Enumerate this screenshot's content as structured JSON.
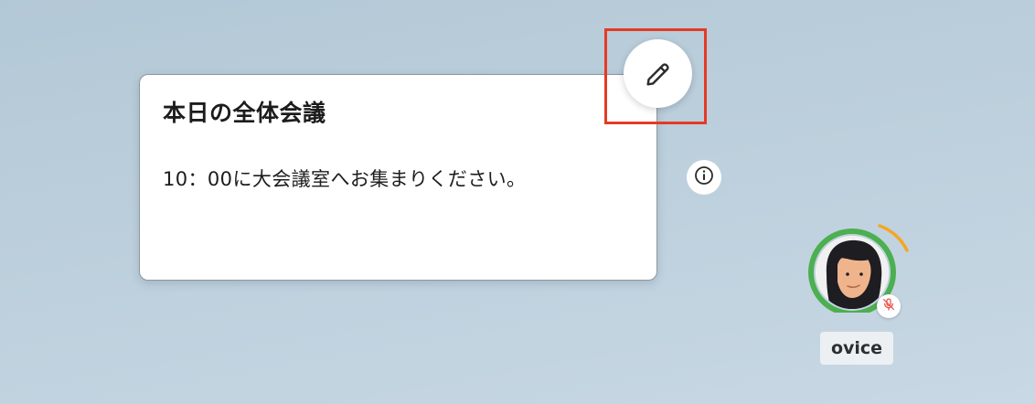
{
  "note": {
    "title": "本日の全体会議",
    "body": "10：00に大会議室へお集まりください。"
  },
  "edit_button": {
    "icon": "pencil-icon",
    "highlight_color": "#e53a24"
  },
  "info_button": {
    "icon": "info-icon"
  },
  "user": {
    "name": "ovice",
    "status_ring_color": "#4caf50",
    "activity_arc_color": "#f5a623",
    "mic_status": "muted",
    "mic_icon": "mic-off-icon",
    "mic_icon_color": "#e8554e"
  }
}
